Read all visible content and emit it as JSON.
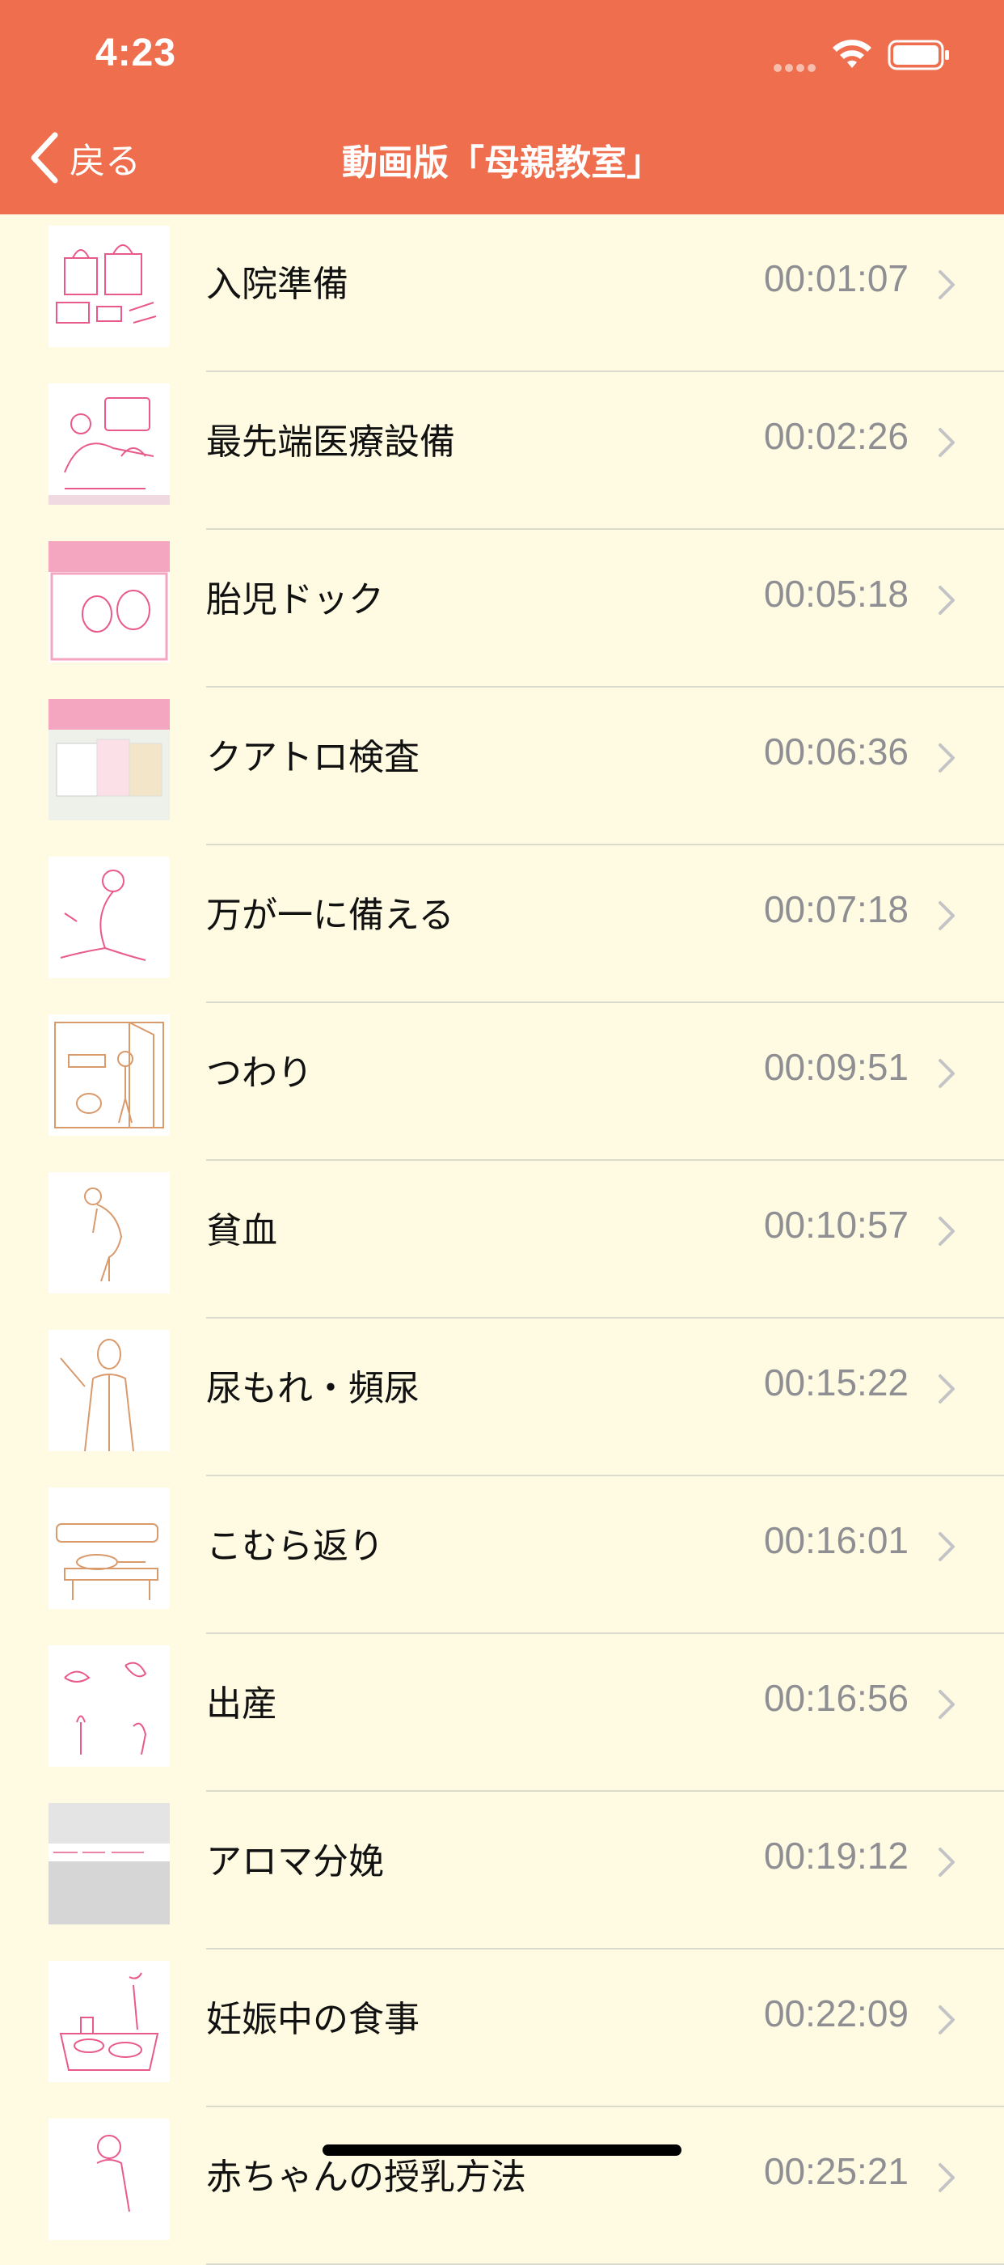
{
  "status": {
    "time": "4:23"
  },
  "nav": {
    "back_label": "戻る",
    "title": "動画版「母親教室」"
  },
  "colors": {
    "header": "#EE6E4D",
    "background": "#FEFBE2",
    "duration": "#8E8E93",
    "separator": "#DCDCCC"
  },
  "items": [
    {
      "label": "入院準備",
      "duration": "00:01:07"
    },
    {
      "label": "最先端医療設備",
      "duration": "00:02:26"
    },
    {
      "label": "胎児ドック",
      "duration": "00:05:18"
    },
    {
      "label": "クアトロ検査",
      "duration": "00:06:36"
    },
    {
      "label": "万が一に備える",
      "duration": "00:07:18"
    },
    {
      "label": "つわり",
      "duration": "00:09:51"
    },
    {
      "label": "貧血",
      "duration": "00:10:57"
    },
    {
      "label": "尿もれ・頻尿",
      "duration": "00:15:22"
    },
    {
      "label": "こむら返り",
      "duration": "00:16:01"
    },
    {
      "label": "出産",
      "duration": "00:16:56"
    },
    {
      "label": "アロマ分娩",
      "duration": "00:19:12"
    },
    {
      "label": "妊娠中の食事",
      "duration": "00:22:09"
    },
    {
      "label": "赤ちゃんの授乳方法",
      "duration": "00:25:21"
    }
  ]
}
